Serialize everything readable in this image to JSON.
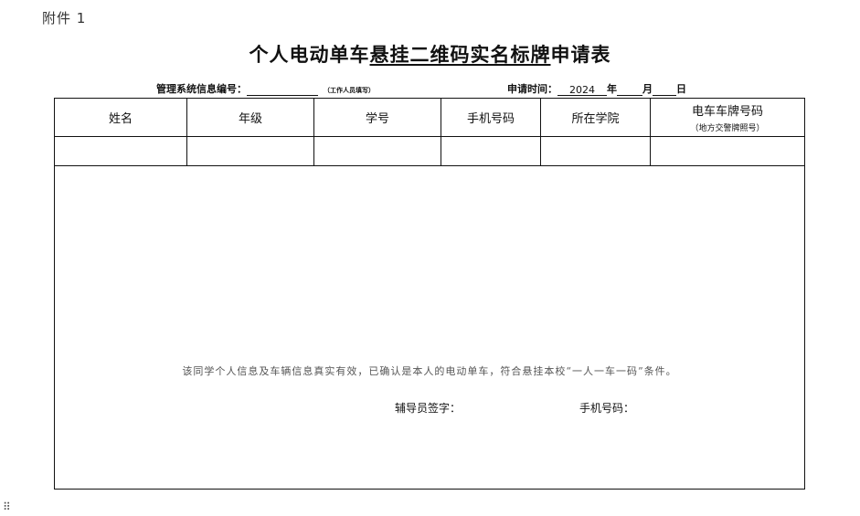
{
  "attachment_label": "附件 1",
  "title": {
    "part1": "个人电动单车",
    "underlined": "悬挂二维码实名标牌",
    "part2": "申请表"
  },
  "meta": {
    "mgmt_label": "管理系统信息编号：",
    "mgmt_value": "",
    "mgmt_note": "（工作人员填写）",
    "date_label": "申请时间：",
    "year_value": "2024",
    "year_label": "年",
    "month_value": "",
    "month_label": "月",
    "day_value": "",
    "day_label": "日"
  },
  "table": {
    "headers": [
      "姓名",
      "年级",
      "学号",
      "手机号码",
      "所在学院",
      "电车车牌号码"
    ],
    "header_sub": "（地方交警牌照号）",
    "row": [
      "",
      "",
      "",
      "",
      "",
      ""
    ]
  },
  "confirmation": "该同学个人信息及车辆信息真实有效，已确认是本人的电动单车，符合悬挂本校“一人一车一码”条件。",
  "signature": {
    "counselor_label": "辅导员签字：",
    "phone_label": "手机号码："
  },
  "drag_handle_glyph": "⠿"
}
